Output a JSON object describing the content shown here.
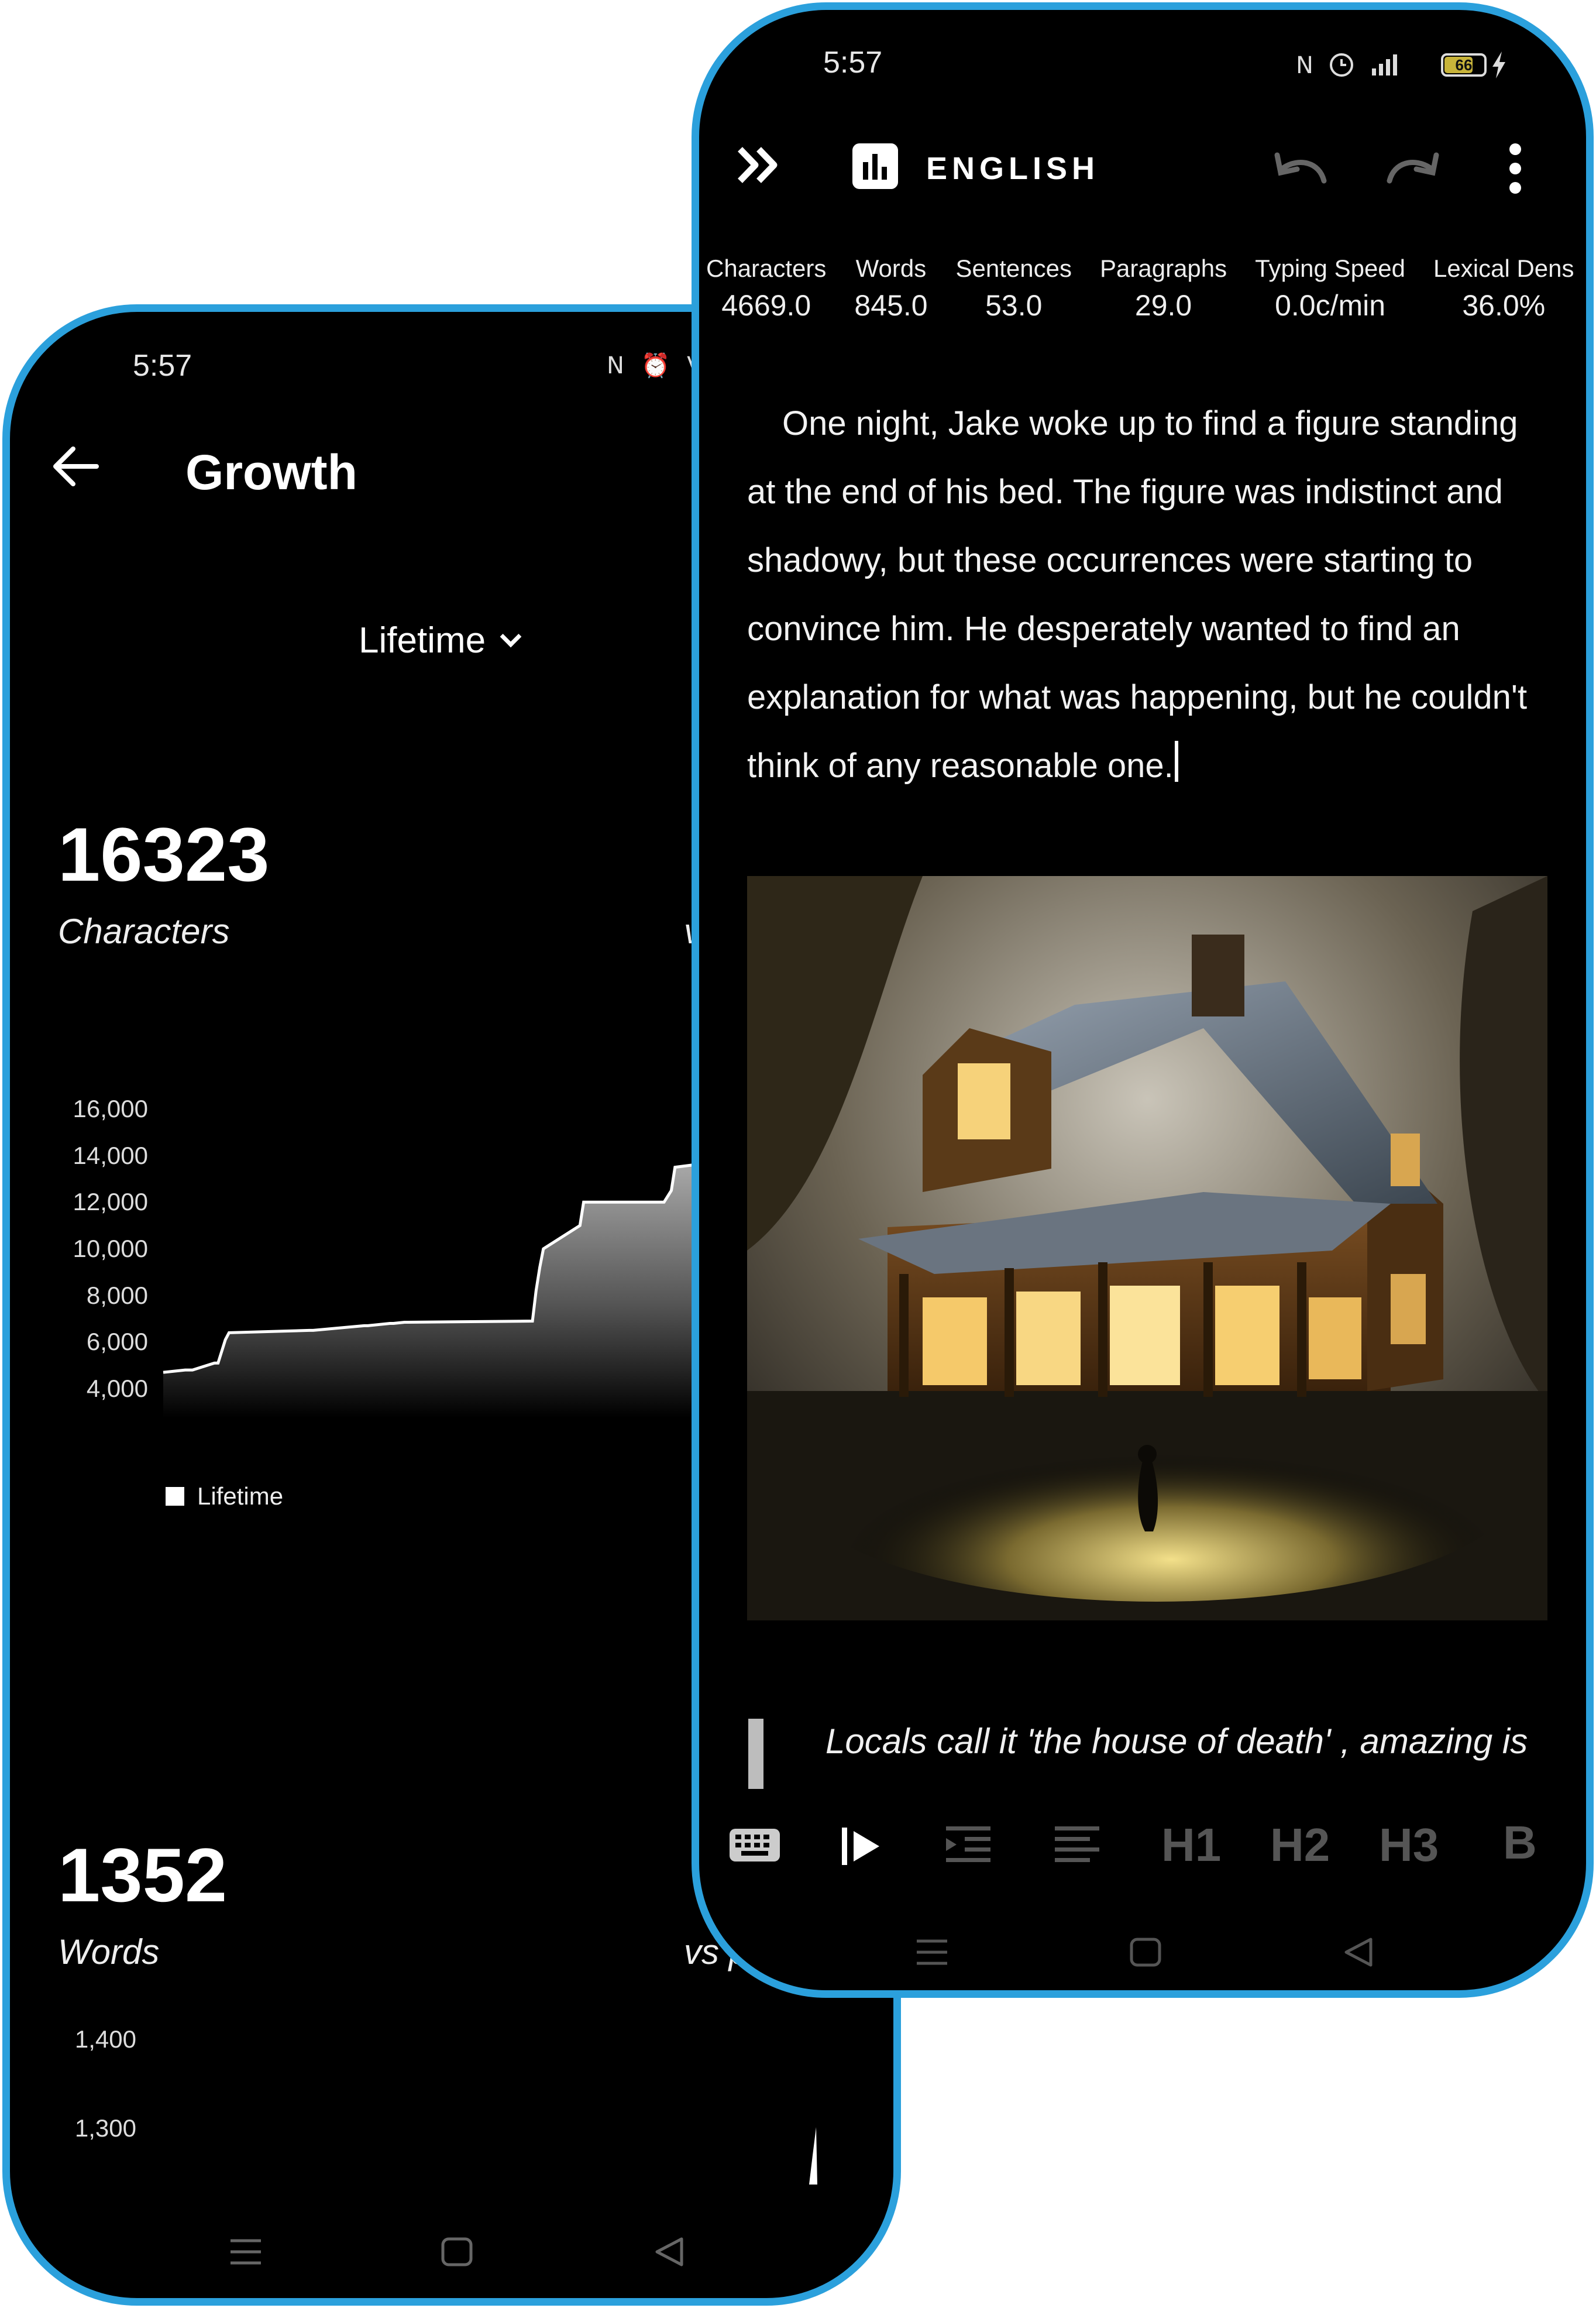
{
  "growth_screen": {
    "status_bar": {
      "time": "5:57",
      "icons": "N ⏰ Vo"
    },
    "title": "Growth",
    "period_selector": "Lifetime",
    "characters": {
      "value": "16323",
      "label": "Characters",
      "comparison_label": "v"
    },
    "words": {
      "value": "1352",
      "label": "Words",
      "comparison_label": "vs p"
    },
    "chart_data": [
      {
        "type": "area",
        "series": [
          {
            "name": "Lifetime",
            "x": [
              0,
              6,
              8,
              14,
              15,
              17,
              18,
              40,
              41,
              55,
              56,
              62,
              63,
              66,
              67,
              101,
              102,
              103,
              104,
              114,
              115,
              136,
              137,
              139,
              140,
              145
            ],
            "values": [
              4700,
              4800,
              4800,
              5100,
              5100,
              6100,
              6400,
              6500,
              6500,
              6700,
              6700,
              6800,
              6800,
              6850,
              6850,
              6900,
              8200,
              9200,
              10000,
              11000,
              12000,
              12000,
              12000,
              12500,
              13500,
              13600
            ]
          }
        ],
        "yticks": [
          "16,000",
          "14,000",
          "12,000",
          "10,000",
          "8,000",
          "6,000",
          "4,000"
        ],
        "ylim": [
          4000,
          16000
        ],
        "legend": "Lifetime",
        "legend_position": "bottom-left"
      },
      {
        "type": "area",
        "yticks": [
          "1,400",
          "1,300"
        ],
        "ylim": [
          1300,
          1400
        ]
      }
    ]
  },
  "editor_screen": {
    "status_bar": {
      "time": "5:57",
      "battery": "66"
    },
    "language": "ENGLISH",
    "stats": [
      {
        "label": "Characters",
        "value": "4669.0"
      },
      {
        "label": "Words",
        "value": "845.0"
      },
      {
        "label": "Sentences",
        "value": "53.0"
      },
      {
        "label": "Paragraphs",
        "value": "29.0"
      },
      {
        "label": "Typing Speed",
        "value": "0.0c/min"
      },
      {
        "label": "Lexical Dens",
        "value": "36.0%"
      }
    ],
    "paragraph": "One night, Jake woke up to find a figure standing at the end of his bed. The figure was indistinct and shadowy, but these occurrences were starting to convince him. He desperately wanted to find an explanation for what was happening, but he couldn't think of any reasonable one.",
    "caption": "Locals call it 'the house of death' , amazing is",
    "format_toolbar": [
      "H1",
      "H2",
      "H3",
      "B"
    ]
  },
  "icons": [
    "back-arrow-icon",
    "chevron-down-icon",
    "double-chevron-icon",
    "chart-icon",
    "undo-icon",
    "redo-icon",
    "more-vertical-icon",
    "keyboard-icon",
    "play-icon",
    "indent-icon",
    "align-icon",
    "menu-icon",
    "home-icon",
    "back-icon"
  ],
  "colors": {
    "frame": "#2ba0dc",
    "background": "#000000",
    "text": "#ffffff"
  }
}
